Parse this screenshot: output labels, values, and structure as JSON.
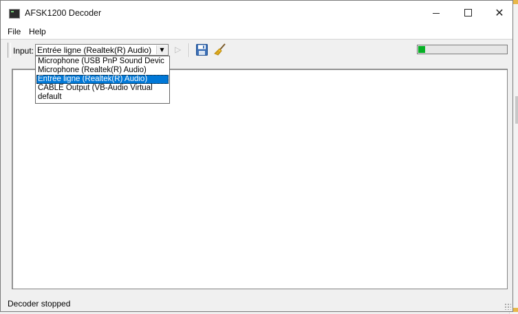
{
  "window": {
    "title": "AFSK1200 Decoder",
    "controls": {
      "minimize_icon": "minimize-icon",
      "maximize_icon": "maximize-icon",
      "close_icon": "close-icon"
    }
  },
  "menu": {
    "file": "File",
    "help": "Help"
  },
  "toolbar": {
    "input_label": "Input:",
    "input_value": "Entrée ligne (Realtek(R) Audio)",
    "play_icon": "play-icon",
    "save_icon": "save-icon",
    "clear_icon": "broom-icon",
    "level": 0.08,
    "level_color": "#06b025"
  },
  "dropdown": {
    "options": [
      "Microphone (USB PnP Sound Devic",
      "Microphone (Realtek(R) Audio)",
      "Entrée ligne (Realtek(R) Audio)",
      "CABLE Output (VB-Audio Virtual",
      "default"
    ],
    "selected_index": 2,
    "selection_color": "#0078d7"
  },
  "output": {
    "text": ""
  },
  "status": {
    "text": "Decoder stopped"
  }
}
